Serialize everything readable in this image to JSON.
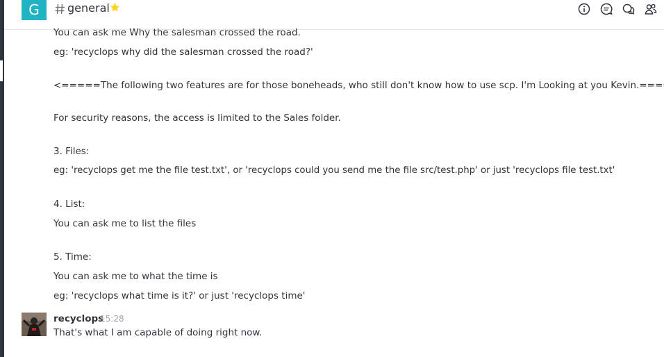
{
  "room": {
    "avatar_letter": "G",
    "name": "general",
    "avatar_color": "#1fb3c4",
    "favorite_color": "#ffd21f"
  },
  "header_icons": [
    "info-icon",
    "threads-icon",
    "discussion-icon",
    "members-icon"
  ],
  "messages": {
    "lines": [
      "You can ask me Why the salesman crossed the road.",
      "eg: 'recyclops why did the salesman crossed the road?'",
      "<=====The following two features are for those boneheads, who still don't know how to use scp. I'm Looking at you Kevin.=====>",
      "For security reasons, the access is limited to the Sales folder.",
      "3. Files:",
      "eg: 'recyclops get me the file test.txt', or 'recyclops could you send me the file src/test.php' or just 'recyclops file test.txt'",
      "4. List:",
      "You can ask me to list the files",
      "5. Time:",
      "You can ask me to what the time is",
      "eg: 'recyclops what time is it?' or just 'recyclops time'"
    ],
    "last": {
      "user": "recyclops",
      "time": "15:28",
      "text": "That's what I am capable of doing right now."
    }
  }
}
